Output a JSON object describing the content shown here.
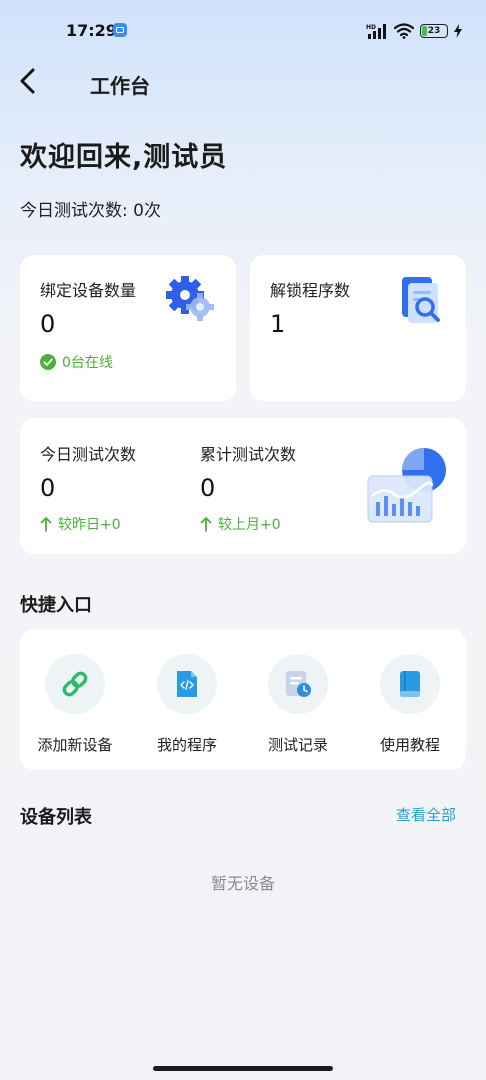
{
  "status_bar": {
    "time": "17:29",
    "network": "HD",
    "battery": "23"
  },
  "header": {
    "title": "工作台"
  },
  "welcome": "欢迎回来,测试员",
  "today_test_count": "今日测试次数: 0次",
  "stats": {
    "devices": {
      "label": "绑定设备数量",
      "value": "0",
      "sub": "0台在线",
      "icon": "gear-icon"
    },
    "unlock": {
      "label": "解锁程序数",
      "value": "1",
      "icon": "document-search-icon"
    },
    "today": {
      "label": "今日测试次数",
      "value": "0",
      "sub": "较昨日+0"
    },
    "total": {
      "label": "累计测试次数",
      "value": "0",
      "sub": "较上月+0",
      "icon": "chart-icon"
    }
  },
  "quick": {
    "title": "快捷入口",
    "items": [
      {
        "label": "添加新设备",
        "icon": "link-icon"
      },
      {
        "label": "我的程序",
        "icon": "code-file-icon"
      },
      {
        "label": "测试记录",
        "icon": "record-clock-icon"
      },
      {
        "label": "使用教程",
        "icon": "book-icon"
      }
    ]
  },
  "device_list": {
    "title": "设备列表",
    "view_all": "查看全部",
    "empty_text": "暂无设备"
  },
  "colors": {
    "accent_blue": "#2f6ff0",
    "success_green": "#4caf3b",
    "link_color": "#2b9fc8",
    "quick_green": "#2dbb6a"
  }
}
